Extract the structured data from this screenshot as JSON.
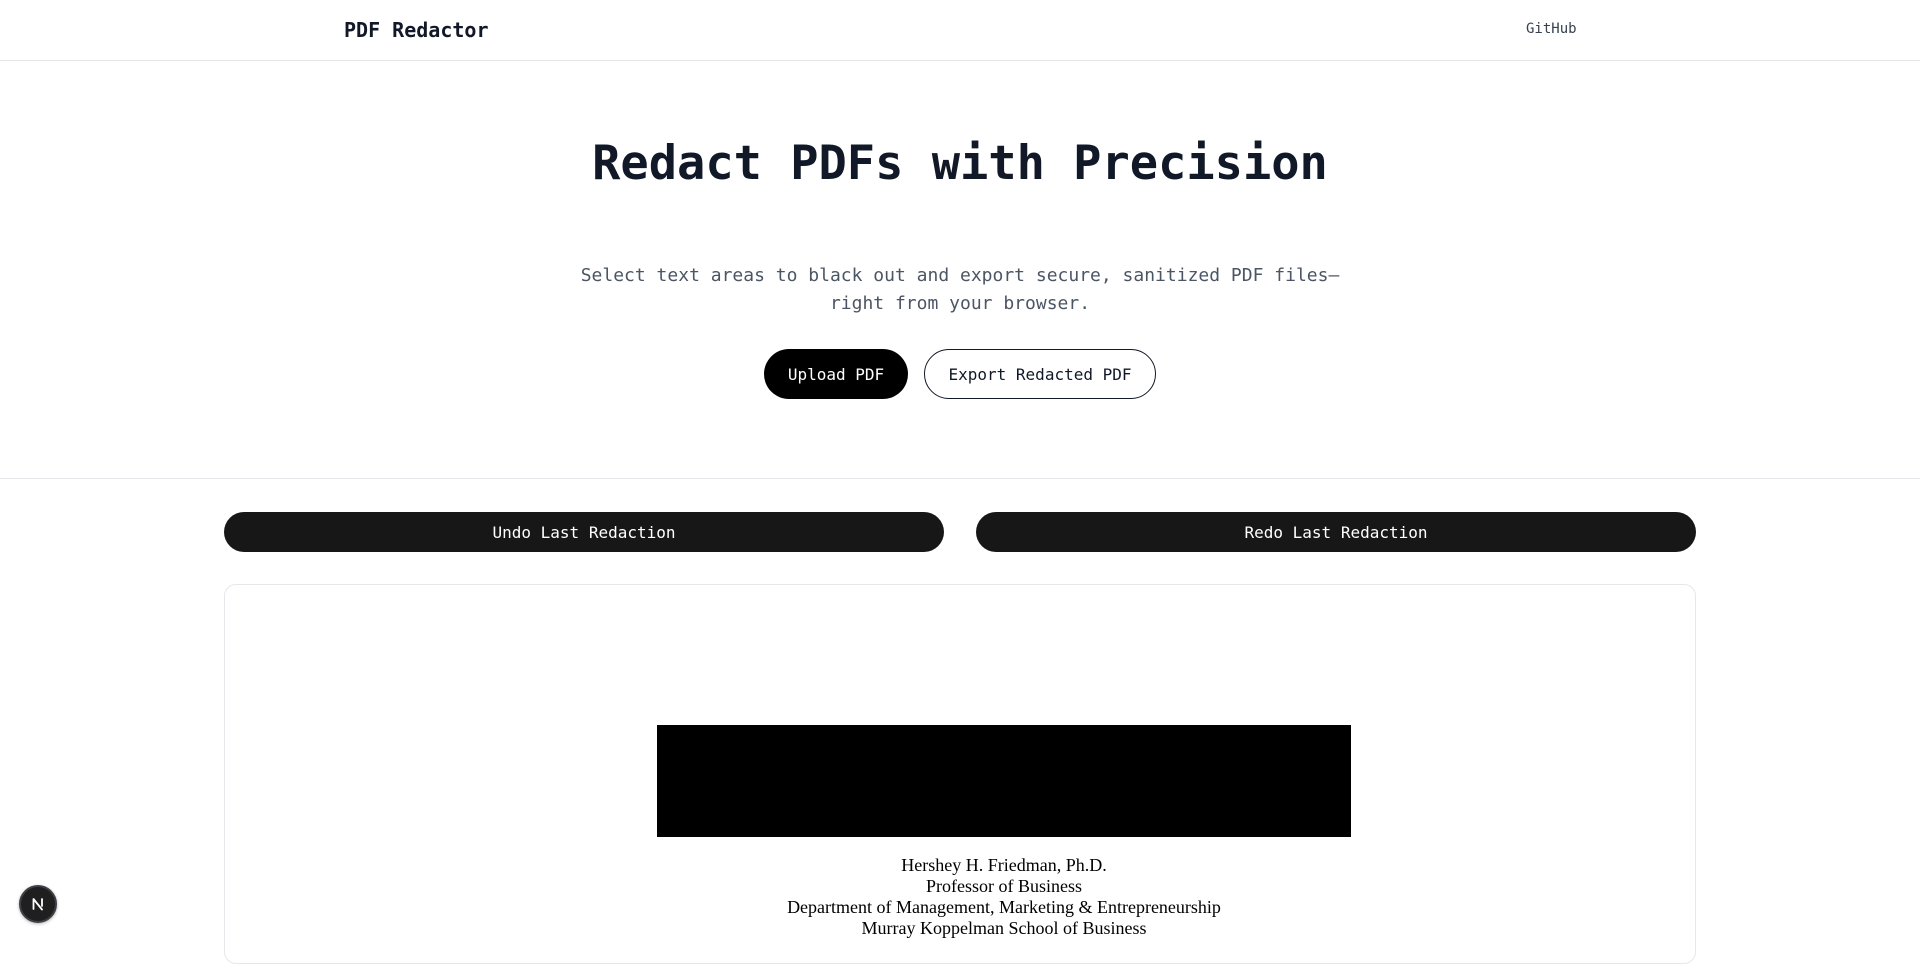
{
  "nav": {
    "brand": "PDF Redactor",
    "github_label": "GitHub"
  },
  "hero": {
    "title": "Redact PDFs with Precision",
    "subtitle": "Select text areas to black out and export secure, sanitized PDF files—right from your browser.",
    "upload_label": "Upload PDF",
    "export_label": "Export Redacted PDF"
  },
  "toolbar": {
    "undo_label": "Undo Last Redaction",
    "redo_label": "Redo Last Redaction"
  },
  "pdf": {
    "lines": [
      "Hershey H. Friedman, Ph.D.",
      "Professor of Business",
      "Department of Management, Marketing & Entrepreneurship",
      "Murray Koppelman School of Business"
    ]
  },
  "badge": {
    "icon": "nextjs-n-icon",
    "letter": "N"
  }
}
